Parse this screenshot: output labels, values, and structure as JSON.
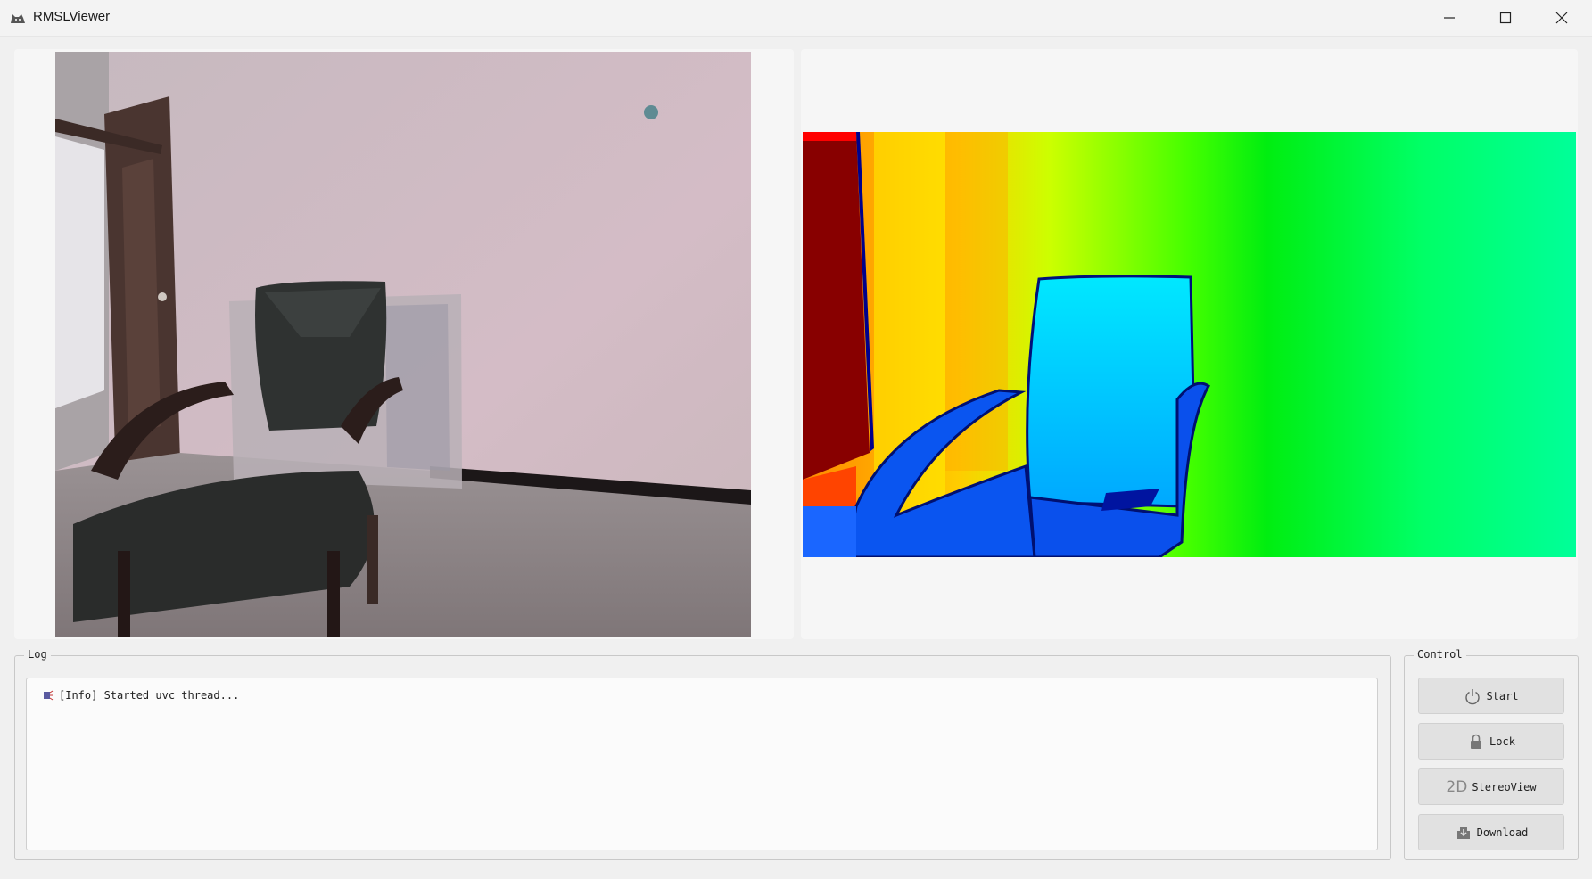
{
  "window": {
    "title": "RMSLViewer",
    "icons": [
      "app-cat-icon",
      "minimize-icon",
      "maximize-icon",
      "close-icon"
    ]
  },
  "views": {
    "rgb": {
      "description_icon": "rgb-camera-frame"
    },
    "depth": {
      "description_icon": "depth-colormap-frame"
    }
  },
  "log": {
    "title": "Log",
    "entries": [
      {
        "icon": "info-icon",
        "text": "[Info] Started uvc thread..."
      }
    ]
  },
  "control": {
    "title": "Control",
    "buttons": [
      {
        "label": "Start",
        "icon": "power-icon"
      },
      {
        "label": "Lock",
        "icon": "lock-icon"
      },
      {
        "label": "StereoView",
        "icon": "2d-icon",
        "icon_text": "2D"
      },
      {
        "label": "Download",
        "icon": "download-icon"
      }
    ]
  },
  "colors": {
    "window_bg": "#f0f0f0",
    "panel_bg": "#f6f6f6",
    "button_bg": "#e1e1e1"
  }
}
